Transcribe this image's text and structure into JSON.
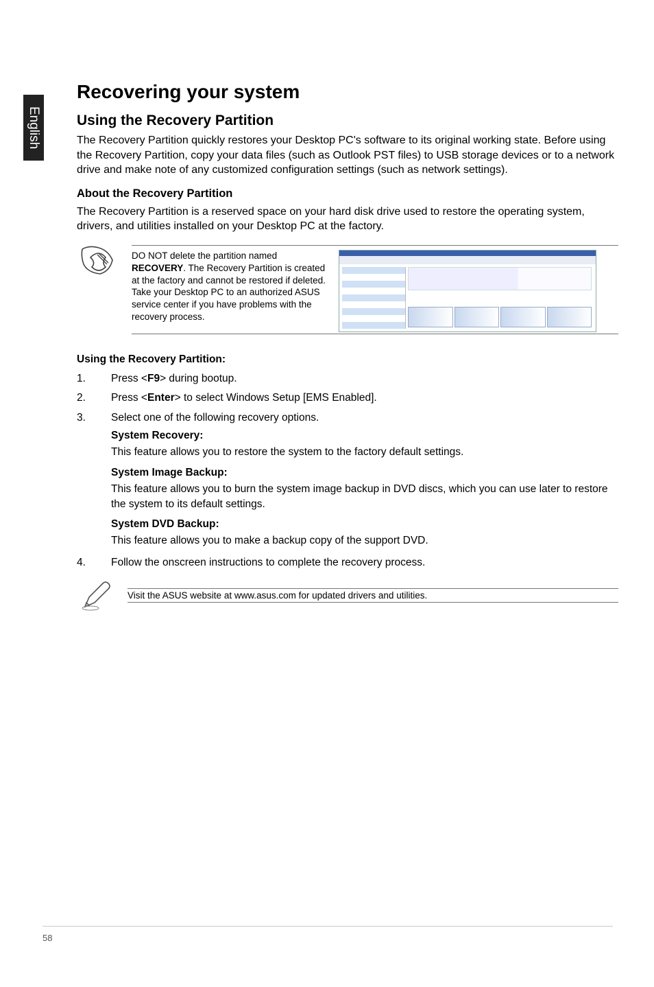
{
  "sideTab": "English",
  "h1": "Recovering your system",
  "h2": "Using the Recovery Partition",
  "p1": "The Recovery Partition quickly restores your Desktop PC's software to its original working state. Before using the Recovery Partition, copy your data files (such as Outlook PST files) to USB storage devices or to a network drive and make note of any customized configuration settings (such as network settings).",
  "h3": "About the Recovery Partition",
  "p2": "The Recovery Partition is a reserved space on your hard disk drive used to restore the operating system, drivers, and utilities installed on your Desktop PC at the factory.",
  "note": {
    "prefix": "DO NOT delete the partition named ",
    "boldWord": "RECOVERY",
    "suffix": ". The Recovery Partition is created at the factory and cannot be restored if deleted. Take your Desktop PC to an authorized ASUS service center if you have problems with the recovery process."
  },
  "h4": "Using the Recovery Partition:",
  "steps": [
    {
      "num": "1.",
      "pre": "Press <",
      "bold": "F9",
      "post": "> during bootup."
    },
    {
      "num": "2.",
      "pre": "Press <",
      "bold": "Enter",
      "post": "> to select Windows Setup [EMS Enabled]."
    },
    {
      "num": "3.",
      "plain": "Select one of the following recovery options."
    }
  ],
  "subs": [
    {
      "head": "System Recovery:",
      "body": "This feature allows you to restore the system to the factory default settings."
    },
    {
      "head": "System Image Backup:",
      "body": "This feature allows you to burn the system image backup in DVD discs, which you can use later to restore the system to its default settings."
    },
    {
      "head": "System DVD Backup:",
      "body": "This feature allows you to make a backup copy of the support DVD."
    }
  ],
  "step4": {
    "num": "4.",
    "plain": "Follow the onscreen instructions to complete the recovery process."
  },
  "footnote": "Visit the ASUS website at www.asus.com for updated drivers and utilities.",
  "pageNum": "58"
}
